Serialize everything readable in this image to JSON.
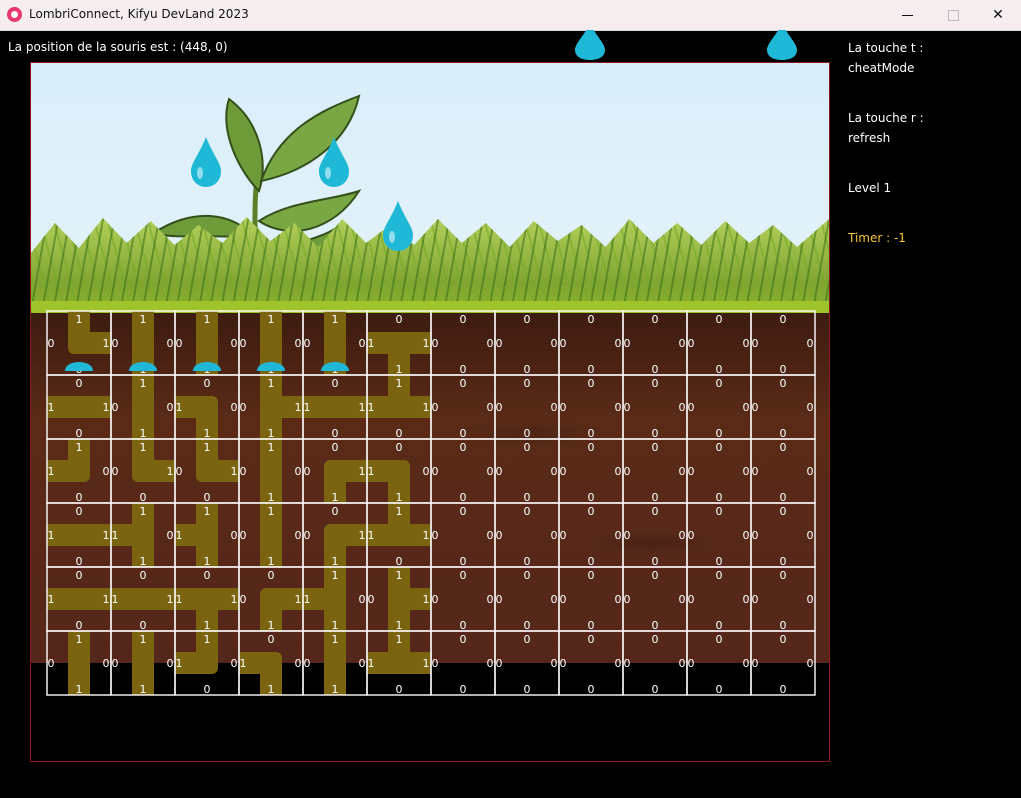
{
  "window": {
    "title": "LombriConnect, Kifyu DevLand 2023",
    "app_icon": "heart-app-icon"
  },
  "mouse_position_text": "La position de la souris est : (448, 0)",
  "sidebar": {
    "t_key_line1": "La touche t :",
    "t_key_line2": "cheatMode",
    "r_key_line1": "La touche r :",
    "r_key_line2": "refresh",
    "level": "Level 1",
    "timer": "Timer : -1",
    "timer_color": "#f6c33a"
  },
  "colors": {
    "sky": "#d9eefa",
    "soil": "#5a2a17",
    "tunnel": "#7a6410",
    "board_border": "#8b1a1a",
    "drop": "#1fb8d6"
  },
  "grid": {
    "rows": 6,
    "cols": 12,
    "cells": [
      [
        [
          1,
          1,
          0,
          0
        ],
        [
          1,
          0,
          1,
          0
        ],
        [
          1,
          0,
          1,
          0
        ],
        [
          1,
          0,
          1,
          0
        ],
        [
          1,
          0,
          1,
          0
        ],
        [
          0,
          1,
          1,
          1
        ],
        [
          0,
          0,
          0,
          0
        ],
        [
          0,
          0,
          0,
          0
        ],
        [
          0,
          0,
          0,
          0
        ],
        [
          0,
          0,
          0,
          0
        ],
        [
          0,
          0,
          0,
          0
        ],
        [
          0,
          0,
          0,
          0
        ]
      ],
      [
        [
          0,
          1,
          0,
          1
        ],
        [
          1,
          0,
          1,
          0
        ],
        [
          0,
          0,
          1,
          1
        ],
        [
          1,
          1,
          1,
          0
        ],
        [
          0,
          1,
          0,
          1
        ],
        [
          1,
          1,
          0,
          1
        ],
        [
          0,
          0,
          0,
          0
        ],
        [
          0,
          0,
          0,
          0
        ],
        [
          0,
          0,
          0,
          0
        ],
        [
          0,
          0,
          0,
          0
        ],
        [
          0,
          0,
          0,
          0
        ],
        [
          0,
          0,
          0,
          0
        ]
      ],
      [
        [
          1,
          0,
          0,
          1
        ],
        [
          1,
          1,
          0,
          0
        ],
        [
          1,
          1,
          0,
          0
        ],
        [
          1,
          0,
          1,
          0
        ],
        [
          0,
          1,
          1,
          0
        ],
        [
          0,
          0,
          1,
          1
        ],
        [
          0,
          0,
          0,
          0
        ],
        [
          0,
          0,
          0,
          0
        ],
        [
          0,
          0,
          0,
          0
        ],
        [
          0,
          0,
          0,
          0
        ],
        [
          0,
          0,
          0,
          0
        ],
        [
          0,
          0,
          0,
          0
        ]
      ],
      [
        [
          0,
          1,
          0,
          1
        ],
        [
          1,
          0,
          1,
          1
        ],
        [
          1,
          0,
          1,
          1
        ],
        [
          1,
          0,
          1,
          0
        ],
        [
          0,
          1,
          1,
          0
        ],
        [
          1,
          1,
          0,
          1
        ],
        [
          0,
          0,
          0,
          0
        ],
        [
          0,
          0,
          0,
          0
        ],
        [
          0,
          0,
          0,
          0
        ],
        [
          0,
          0,
          0,
          0
        ],
        [
          0,
          0,
          0,
          0
        ],
        [
          0,
          0,
          0,
          0
        ]
      ],
      [
        [
          0,
          1,
          0,
          1
        ],
        [
          0,
          1,
          0,
          1
        ],
        [
          0,
          1,
          1,
          1
        ],
        [
          0,
          1,
          1,
          0
        ],
        [
          1,
          0,
          1,
          1
        ],
        [
          1,
          1,
          1,
          0
        ],
        [
          0,
          0,
          0,
          0
        ],
        [
          0,
          0,
          0,
          0
        ],
        [
          0,
          0,
          0,
          0
        ],
        [
          0,
          0,
          0,
          0
        ],
        [
          0,
          0,
          0,
          0
        ],
        [
          0,
          0,
          0,
          0
        ]
      ],
      [
        [
          1,
          0,
          1,
          0
        ],
        [
          1,
          0,
          1,
          0
        ],
        [
          1,
          0,
          0,
          1
        ],
        [
          0,
          0,
          1,
          1
        ],
        [
          1,
          0,
          1,
          0
        ],
        [
          1,
          1,
          0,
          1
        ],
        [
          0,
          0,
          0,
          0
        ],
        [
          0,
          0,
          0,
          0
        ],
        [
          0,
          0,
          0,
          0
        ],
        [
          0,
          0,
          0,
          0
        ],
        [
          0,
          0,
          0,
          0
        ],
        [
          0,
          0,
          0,
          0
        ]
      ]
    ]
  }
}
